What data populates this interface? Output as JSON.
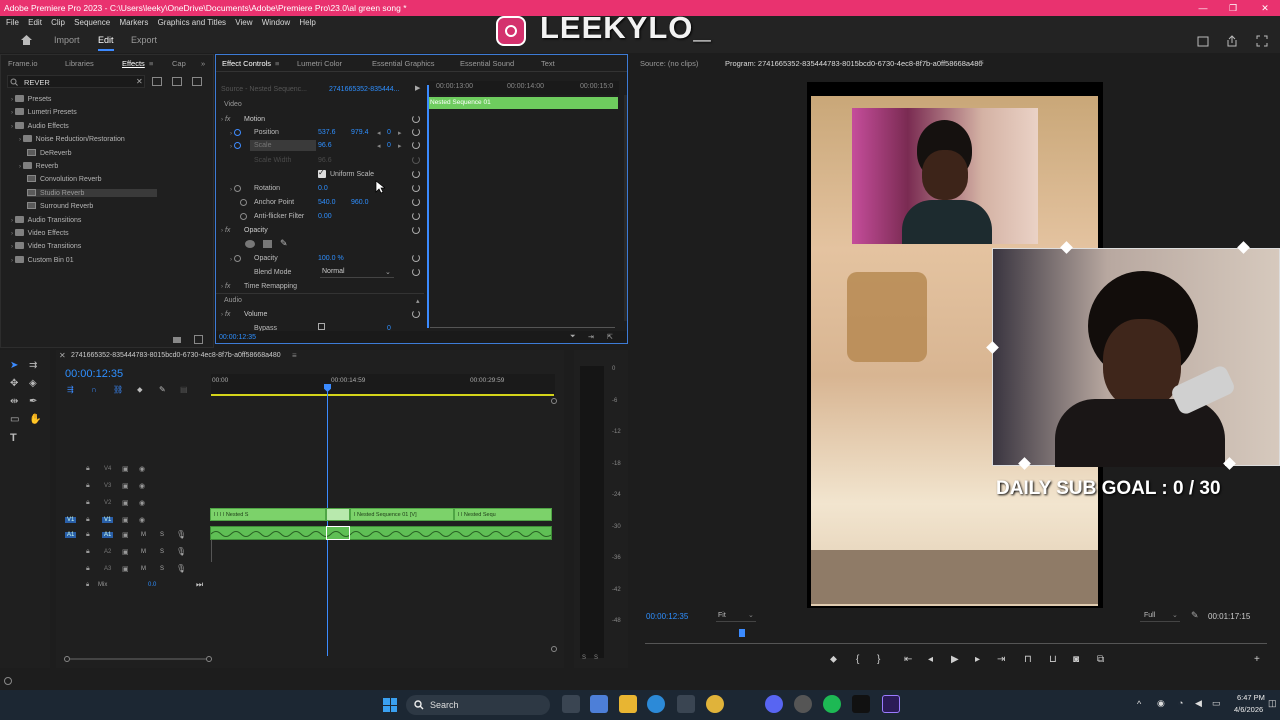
{
  "window": {
    "title": "Adobe Premiere Pro 2023 - C:\\Users\\leeky\\OneDrive\\Documents\\Adobe\\Premiere Pro\\23.0\\al green song *"
  },
  "menu": [
    "File",
    "Edit",
    "Clip",
    "Sequence",
    "Markers",
    "Graphics and Titles",
    "View",
    "Window",
    "Help"
  ],
  "workspace": {
    "import": "Import",
    "edit": "Edit",
    "export": "Export"
  },
  "overlay": {
    "username": "LEEKYLO_",
    "sub_goal": "DAILY SUB GOAL : 0 / 30"
  },
  "effects_panel": {
    "tabs": [
      "Frame.io",
      "Libraries",
      "Effects",
      "Cap"
    ],
    "search": "REVER",
    "tree": [
      {
        "label": "Presets",
        "level": 0,
        "type": "folder"
      },
      {
        "label": "Lumetri Presets",
        "level": 0,
        "type": "folder"
      },
      {
        "label": "Audio Effects",
        "level": 0,
        "type": "folder"
      },
      {
        "label": "Noise Reduction/Restoration",
        "level": 1,
        "type": "folder"
      },
      {
        "label": "DeReverb",
        "level": 2,
        "type": "fx"
      },
      {
        "label": "Reverb",
        "level": 1,
        "type": "folder"
      },
      {
        "label": "Convolution Reverb",
        "level": 2,
        "type": "fx"
      },
      {
        "label": "Studio Reverb",
        "level": 2,
        "type": "fx"
      },
      {
        "label": "Surround Reverb",
        "level": 2,
        "type": "fx"
      },
      {
        "label": "Audio Transitions",
        "level": 0,
        "type": "folder"
      },
      {
        "label": "Video Effects",
        "level": 0,
        "type": "folder"
      },
      {
        "label": "Video Transitions",
        "level": 0,
        "type": "folder"
      },
      {
        "label": "Custom Bin 01",
        "level": 0,
        "type": "folder"
      }
    ]
  },
  "effect_controls": {
    "tabs": [
      "Effect Controls",
      "Lumetri Color",
      "Essential Graphics",
      "Essential Sound",
      "Text"
    ],
    "source": "Source - Nested Sequenc...",
    "seq": "2741665352-835444...",
    "mini_times": [
      "00:00:13:00",
      "00:00:14:00",
      "00:00:15:0"
    ],
    "mini_clip": "Nested Sequence 01",
    "video_header": "Video",
    "motion": "Motion",
    "position": {
      "label": "Position",
      "x": "537.6",
      "y": "979.4",
      "kf": "0"
    },
    "scale": {
      "label": "Scale",
      "value": "96.6",
      "kf": "0"
    },
    "scale_width": {
      "label": "Scale Width",
      "value": "96.6"
    },
    "uniform_scale": "Uniform Scale",
    "rotation": {
      "label": "Rotation",
      "value": "0.0"
    },
    "anchor": {
      "label": "Anchor Point",
      "x": "540.0",
      "y": "960.0"
    },
    "antiflicker": {
      "label": "Anti-flicker Filter",
      "value": "0.00"
    },
    "opacity_group": "Opacity",
    "opacity": {
      "label": "Opacity",
      "value": "100.0 %"
    },
    "blend": {
      "label": "Blend Mode",
      "value": "Normal"
    },
    "time_remap": "Time Remapping",
    "audio_header": "Audio",
    "volume": "Volume",
    "bypass": "Bypass",
    "bypass_kf": "0",
    "timecode": "00:00:12:35"
  },
  "source_monitor": {
    "label": "Source: (no clips)"
  },
  "program_monitor": {
    "label": "Program: 2741665352-835444783-8015bcd0-6730-4ec8-8f7b-a0ff58668a480",
    "timecode": "00:00:12:35",
    "fit": "Fit",
    "quality": "Full",
    "duration": "00:01:17:15"
  },
  "timeline": {
    "seq_name": "2741665352-835444783-8015bcd0-6730-4ec8-8f7b-a0ff58668a480",
    "timecode": "00:00:12:35",
    "ruler": [
      "00:00",
      "00:00:14:59",
      "00:00:29:59"
    ],
    "video_tracks": [
      "V4",
      "V3",
      "V2",
      "V1"
    ],
    "audio_tracks": [
      "A1",
      "A2",
      "A3"
    ],
    "target_v": "V1",
    "target_a": "A1",
    "mute": "M",
    "solo": "S",
    "mix_label": "Mix",
    "mix_value": "0.0",
    "clips": [
      "Nested S",
      "Nested Sequence 01 [V]",
      "Nested Sequ"
    ]
  },
  "meter_scale": [
    "0",
    "-6",
    "-12",
    "-18",
    "-24",
    "-30",
    "-36",
    "-42",
    "-48",
    "S",
    "S"
  ],
  "taskbar": {
    "search": "Search",
    "time": "6:47 PM",
    "date": "4/6/2026"
  }
}
